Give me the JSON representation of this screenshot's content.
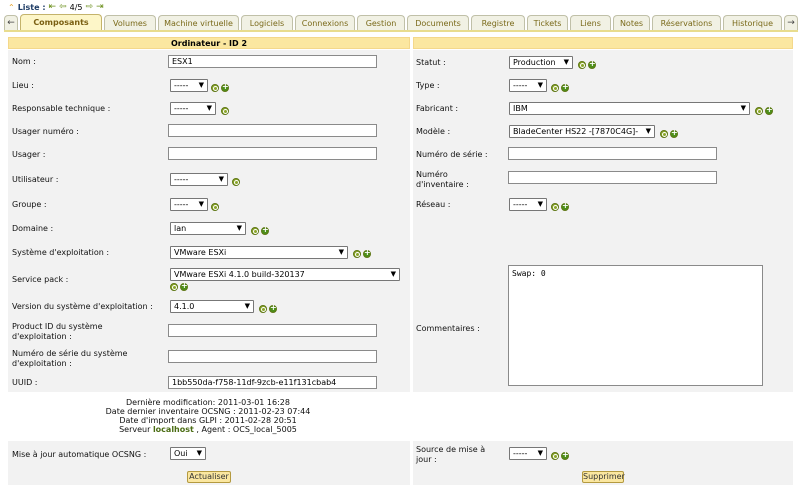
{
  "nav": {
    "list_label": "Liste :",
    "page": "4/5"
  },
  "tabs": [
    "Composants",
    "Volumes",
    "Machine virtuelle",
    "Logiciels",
    "Connexions",
    "Gestion",
    "Documents",
    "Registre",
    "Tickets",
    "Liens",
    "Notes",
    "Réservations",
    "Historique"
  ],
  "header": {
    "left_title": "Ordinateur - ID 2"
  },
  "left": {
    "nom_label": "Nom :",
    "nom_value": "ESX1",
    "lieu_label": "Lieu :",
    "lieu_value": "-----",
    "resp_label": "Responsable technique :",
    "resp_value": "-----",
    "usager_num_label": "Usager numéro :",
    "usager_label": "Usager :",
    "utilisateur_label": "Utilisateur :",
    "utilisateur_value": "-----",
    "groupe_label": "Groupe :",
    "groupe_value": "-----",
    "domaine_label": "Domaine :",
    "domaine_value": "lan",
    "os_label": "Système d'exploitation :",
    "os_value": "VMware ESXi",
    "sp_label": "Service pack :",
    "sp_value": "VMware ESXi 4.1.0 build-320137",
    "version_label": "Version du système d'exploitation :",
    "version_value": "4.1.0",
    "productid_label_1": "Product ID du système",
    "productid_label_2": "d'exploitation :",
    "serialos_label_1": "Numéro de série du système",
    "serialos_label_2": "d'exploitation :",
    "uuid_label": "UUID :",
    "uuid_value": "1bb550da-f758-11df-9zcb-e11f131cbab4",
    "autoupdate_label": "Mise à jour automatique OCSNG :",
    "autoupdate_value": "Oui"
  },
  "info": {
    "line1": "Dernière modification: 2011-03-01 16:28",
    "line2": "Date dernier inventaire OCSNG : 2011-02-23 07:44",
    "line3": "Date d'import dans GLPI : 2011-02-28 20:51",
    "line4_prefix": "Serveur ",
    "line4_server": "localhost",
    "line4_suffix": " , Agent : OCS_local_5005"
  },
  "right": {
    "statut_label": "Statut :",
    "statut_value": "Production",
    "type_label": "Type :",
    "type_value": "-----",
    "fabricant_label": "Fabricant :",
    "fabricant_value": "IBM",
    "modele_label": "Modèle :",
    "modele_value": "BladeCenter HS22 -[7870C4G]-",
    "serial_label": "Numéro de série :",
    "inv_label_1": "Numéro",
    "inv_label_2": "d'inventaire :",
    "reseau_label": "Réseau :",
    "reseau_value": "-----",
    "comment_label": "Commentaires :",
    "comment_value": "Swap: 0",
    "source_label_1": "Source de mise à",
    "source_label_2": "jour :",
    "source_value": "-----"
  },
  "buttons": {
    "update": "Actualiser",
    "delete": "Supprimer"
  },
  "colors": {
    "header_bg": "#fbe7a0",
    "panel_bg": "#f2f2f2",
    "icon_green": "#8aa52a"
  }
}
